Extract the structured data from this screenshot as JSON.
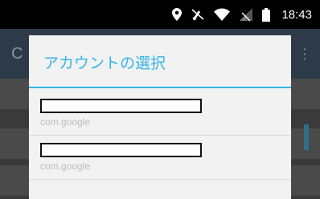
{
  "status_bar": {
    "time": "18:43",
    "icons": [
      "location-icon",
      "mute-icon",
      "wifi-icon",
      "signal-icon",
      "battery-icon"
    ]
  },
  "background_app": {
    "title_fragment": "C",
    "menu_fragment": "⋮"
  },
  "dialog": {
    "title": "アカウントの選択",
    "accent_color": "#33b5e5",
    "accounts": [
      {
        "name": "",
        "type": "com.google"
      },
      {
        "name": "",
        "type": "com.google"
      }
    ]
  }
}
